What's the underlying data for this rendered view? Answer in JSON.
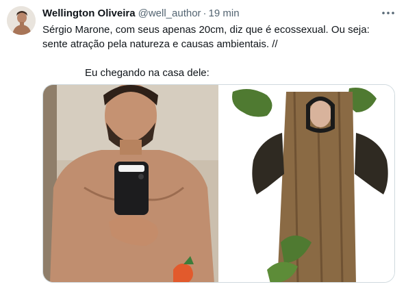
{
  "tweet": {
    "display_name": "Wellington Oliveira",
    "handle": "@well_author",
    "separator": "·",
    "time": "19 min",
    "text_line1": "Sérgio Marone, com seus apenas 20cm, diz que é ecossexual. Ou seja:",
    "text_line2": "sente atração pela natureza e causas ambientais. //",
    "text_line3": "Eu chegando na casa dele:",
    "avatar_icon": "profile-avatar",
    "more_icon": "more-horizontal-icon"
  },
  "media": {
    "left_image": "shirtless-man-mirror-selfie",
    "right_image": "tree-costume-person"
  },
  "colors": {
    "text": "#0f1419",
    "secondary": "#536471",
    "border": "#cfd9de"
  }
}
